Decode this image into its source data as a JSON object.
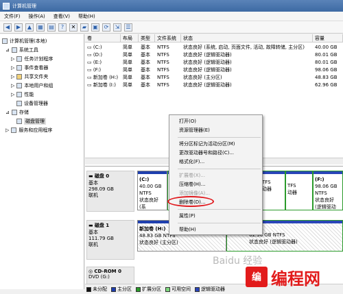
{
  "window": {
    "title": "计算机管理"
  },
  "menu": [
    "文件(F)",
    "操作(A)",
    "查看(V)",
    "帮助(H)"
  ],
  "toolbar_icons": [
    "back-icon",
    "forward-icon",
    "up-folder-icon",
    "console-tree-icon",
    "properties-icon",
    "help-icon",
    "delete-icon",
    "open-icon",
    "save-icon",
    "refresh-icon",
    "export-icon",
    "properties2-icon"
  ],
  "tree": [
    {
      "label": "计算机管理(本地)",
      "depth": 0
    },
    {
      "label": "系统工具",
      "depth": 1
    },
    {
      "label": "任务计划程序",
      "depth": 2
    },
    {
      "label": "事件查看器",
      "depth": 2
    },
    {
      "label": "共享文件夹",
      "depth": 2
    },
    {
      "label": "本地用户和组",
      "depth": 2
    },
    {
      "label": "性能",
      "depth": 2
    },
    {
      "label": "设备管理器",
      "depth": 2
    },
    {
      "label": "存储",
      "depth": 1
    },
    {
      "label": "磁盘管理",
      "depth": 2,
      "selected": true
    },
    {
      "label": "服务和应用程序",
      "depth": 1
    }
  ],
  "volumes": {
    "headers": [
      "卷",
      "布局",
      "类型",
      "文件系统",
      "状态",
      "容量"
    ],
    "rows": [
      [
        "(C:)",
        "简单",
        "基本",
        "NTFS",
        "状态良好 (系统, 启动, 页面文件, 活动, 故障转储, 主分区)",
        "40.00 GB"
      ],
      [
        "(D:)",
        "简单",
        "基本",
        "NTFS",
        "状态良好 (逻辑驱动器)",
        "80.01 GB"
      ],
      [
        "(E:)",
        "简单",
        "基本",
        "NTFS",
        "状态良好 (逻辑驱动器)",
        "80.01 GB"
      ],
      [
        "(F:)",
        "简单",
        "基本",
        "NTFS",
        "状态良好 (逻辑驱动器)",
        "98.06 GB"
      ],
      [
        "新加卷 (H:)",
        "简单",
        "基本",
        "NTFS",
        "状态良好 (主分区)",
        "48.83 GB"
      ],
      [
        "新加卷 (I:)",
        "简单",
        "基本",
        "NTFS",
        "状态良好 (逻辑驱动器)",
        "62.96 GB"
      ]
    ]
  },
  "disks": [
    {
      "name": "磁盘 0",
      "type": "基本",
      "size": "298.09 GB",
      "status": "联机"
    },
    {
      "name": "磁盘 1",
      "type": "基本",
      "size": "111.79 GB",
      "status": "联机"
    },
    {
      "name": "CD-ROM 0",
      "type": "DVD (G:)",
      "size": "",
      "status": ""
    }
  ],
  "partitions": {
    "c": {
      "name": "(C:)",
      "size": "40.00 GB NTFS",
      "status": "状态良好 (系"
    },
    "f": {
      "name": "(F:)",
      "size": "98.06 GB NTFS",
      "status": "状态良好 (逻辑驱动"
    },
    "d": {
      "size": "TFS",
      "status": "动器"
    },
    "e": {
      "size": "TFS",
      "status": "动器"
    },
    "h": {
      "name": "新加卷 (H:)",
      "size": "48.83 GB NTFS",
      "status": "状态良好 (主分区)"
    },
    "i": {
      "size": "62.96 GB NTFS",
      "status": "状态良好 (逻辑驱动器)"
    }
  },
  "context_menu": {
    "items": [
      {
        "label": "打开(O)"
      },
      {
        "label": "资源管理器(E)"
      },
      {
        "sep": true
      },
      {
        "label": "将分区标记为活动分区(M)"
      },
      {
        "label": "更改驱动器号和路径(C)..."
      },
      {
        "label": "格式化(F)..."
      },
      {
        "sep": true
      },
      {
        "label": "扩展卷(X)...",
        "disabled": true
      },
      {
        "label": "压缩卷(H)..."
      },
      {
        "label": "添加镜像(A)...",
        "disabled": true
      },
      {
        "label": "删除卷(D)...",
        "highlighted": true
      },
      {
        "sep": true
      },
      {
        "label": "属性(P)"
      },
      {
        "sep": true
      },
      {
        "label": "帮助(H)"
      }
    ]
  },
  "legend": [
    {
      "label": "未分配",
      "color": "#111111"
    },
    {
      "label": "主分区",
      "color": "#1f3fae"
    },
    {
      "label": "扩展分区",
      "color": "#2a9a2a"
    },
    {
      "label": "可用空间",
      "color": "#7ed87e"
    },
    {
      "label": "逻辑驱动器",
      "color": "#2a45b8"
    }
  ],
  "watermark": {
    "logo": "编",
    "text": "编程网",
    "baidu": "Baidu 经验"
  },
  "colors": {
    "primary_bar": "#1f3fae",
    "logical_bar": "#2a45b8",
    "extended_border": "#2a9a2a",
    "highlight_circle": "#e0191d"
  }
}
